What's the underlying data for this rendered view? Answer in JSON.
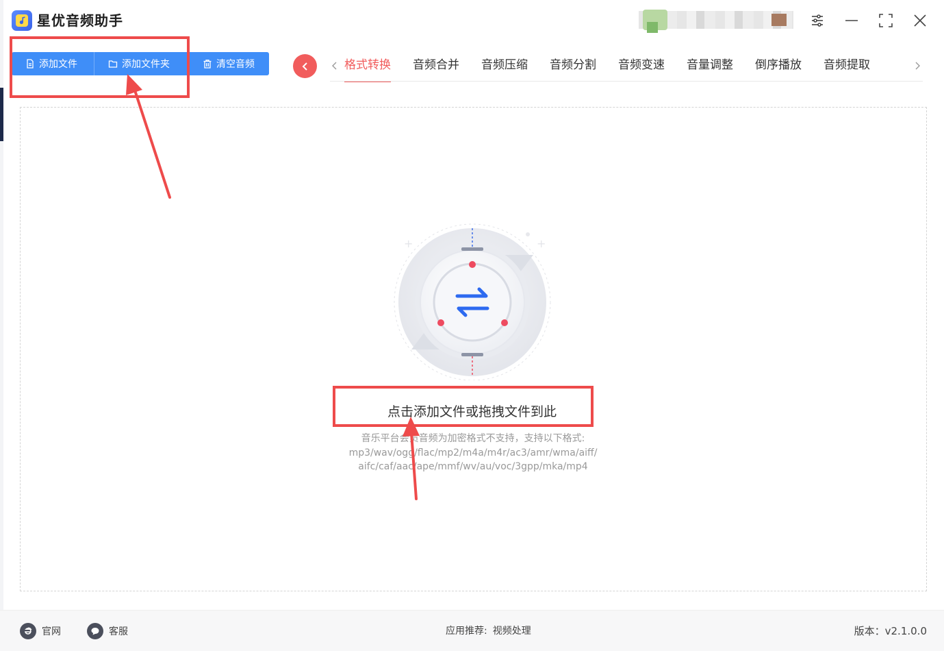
{
  "app": {
    "title": "星优音频助手"
  },
  "toolbar": {
    "add_file": "添加文件",
    "add_folder": "添加文件夹",
    "clear_audio": "清空音频"
  },
  "tabs": [
    {
      "label": "格式转换",
      "active": true
    },
    {
      "label": "音频合并"
    },
    {
      "label": "音频压缩"
    },
    {
      "label": "音频分割"
    },
    {
      "label": "音频变速"
    },
    {
      "label": "音量调整"
    },
    {
      "label": "倒序播放"
    },
    {
      "label": "音频提取"
    }
  ],
  "drop_zone": {
    "prompt": "点击添加文件或拖拽文件到此",
    "note_line1": "音乐平台会员音频为加密格式不支持，支持以下格式:",
    "note_line2": "mp3/wav/ogg/flac/mp2/m4a/m4r/ac3/amr/wma/aiff/",
    "note_line3": "aifc/caf/aac/ape/mmf/wv/au/voc/3gpp/mka/mp4"
  },
  "footer": {
    "website": "官网",
    "support": "客服",
    "recommend_label": "应用推荐:",
    "recommend_link": "视频处理",
    "version": "版本：v2.1.0.0"
  },
  "colors": {
    "primary": "#3f8ef8",
    "accent": "#f15c5c",
    "annotation": "#ee4b4b"
  },
  "icons": {
    "logo": "music-note-icon",
    "settings": "sliders-icon",
    "minimize": "minimize-icon",
    "maximize": "fullscreen-icon",
    "close": "close-icon",
    "add_file": "file-icon",
    "add_folder": "folder-icon",
    "clear": "trash-icon",
    "nav_back": "chevron-left-icon",
    "drop": "swap-arrows-icon",
    "website": "ie-icon",
    "support": "chat-icon"
  }
}
